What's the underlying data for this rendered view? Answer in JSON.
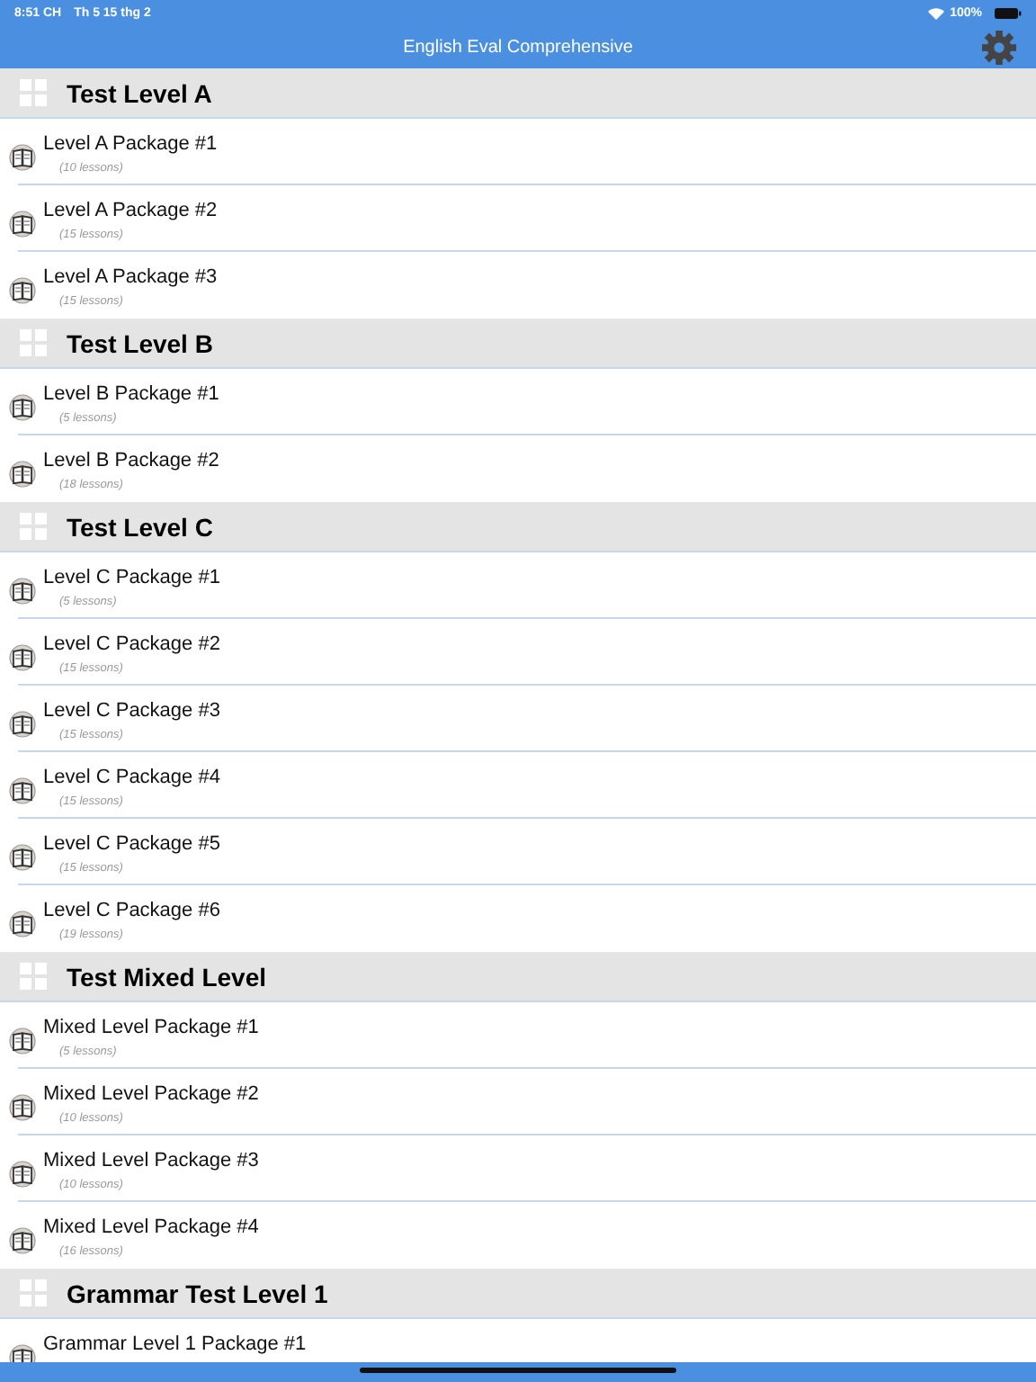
{
  "status_bar": {
    "time": "8:51 CH",
    "date": "Th 5 15 thg 2",
    "battery": "100%"
  },
  "nav_bar": {
    "title": "English Eval Comprehensive"
  },
  "sections": [
    {
      "title": "Test Level A",
      "items": [
        {
          "title": "Level A Package #1",
          "subtitle": "(10 lessons)"
        },
        {
          "title": "Level A Package #2",
          "subtitle": "(15 lessons)"
        },
        {
          "title": "Level A Package #3",
          "subtitle": "(15 lessons)"
        }
      ]
    },
    {
      "title": "Test Level B",
      "items": [
        {
          "title": "Level B Package #1",
          "subtitle": "(5 lessons)"
        },
        {
          "title": "Level B Package #2",
          "subtitle": "(18 lessons)"
        }
      ]
    },
    {
      "title": "Test Level C",
      "items": [
        {
          "title": "Level C Package #1",
          "subtitle": "(5 lessons)"
        },
        {
          "title": "Level C Package #2",
          "subtitle": "(15 lessons)"
        },
        {
          "title": "Level C Package #3",
          "subtitle": "(15 lessons)"
        },
        {
          "title": "Level C Package #4",
          "subtitle": "(15 lessons)"
        },
        {
          "title": "Level C Package #5",
          "subtitle": "(15 lessons)"
        },
        {
          "title": "Level C Package #6",
          "subtitle": "(19 lessons)"
        }
      ]
    },
    {
      "title": "Test Mixed Level",
      "items": [
        {
          "title": "Mixed Level Package #1",
          "subtitle": "(5 lessons)"
        },
        {
          "title": "Mixed Level Package #2",
          "subtitle": "(10 lessons)"
        },
        {
          "title": "Mixed Level Package #3",
          "subtitle": "(10 lessons)"
        },
        {
          "title": "Mixed Level Package #4",
          "subtitle": "(16 lessons)"
        }
      ]
    },
    {
      "title": "Grammar Test Level 1",
      "items": [
        {
          "title": "Grammar Level 1 Package #1"
        }
      ]
    }
  ]
}
